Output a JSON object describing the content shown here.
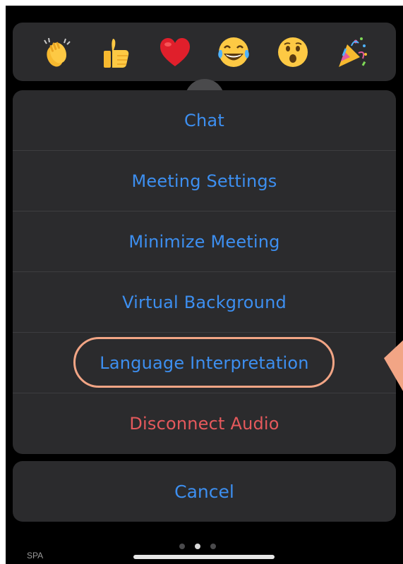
{
  "reactions": [
    {
      "icon": "clapping-hands-icon"
    },
    {
      "icon": "thumbs-up-icon"
    },
    {
      "icon": "red-heart-icon"
    },
    {
      "icon": "tears-of-joy-icon"
    },
    {
      "icon": "surprised-face-icon"
    },
    {
      "icon": "party-popper-icon"
    }
  ],
  "menu": {
    "items": [
      {
        "label": "Chat"
      },
      {
        "label": "Meeting Settings"
      },
      {
        "label": "Minimize Meeting"
      },
      {
        "label": "Virtual Background"
      },
      {
        "label": "Language Interpretation",
        "highlighted": true
      },
      {
        "label": "Disconnect Audio",
        "destructive": true
      }
    ],
    "cancel_label": "Cancel"
  },
  "footer": {
    "corner_label": "SPA",
    "page_count": 3,
    "active_page": 2
  },
  "colors": {
    "action_blue": "#3d8ff0",
    "destructive_red": "#e5595c",
    "highlight_ring": "#f2a585",
    "card_bg": "#2b2b2d"
  }
}
